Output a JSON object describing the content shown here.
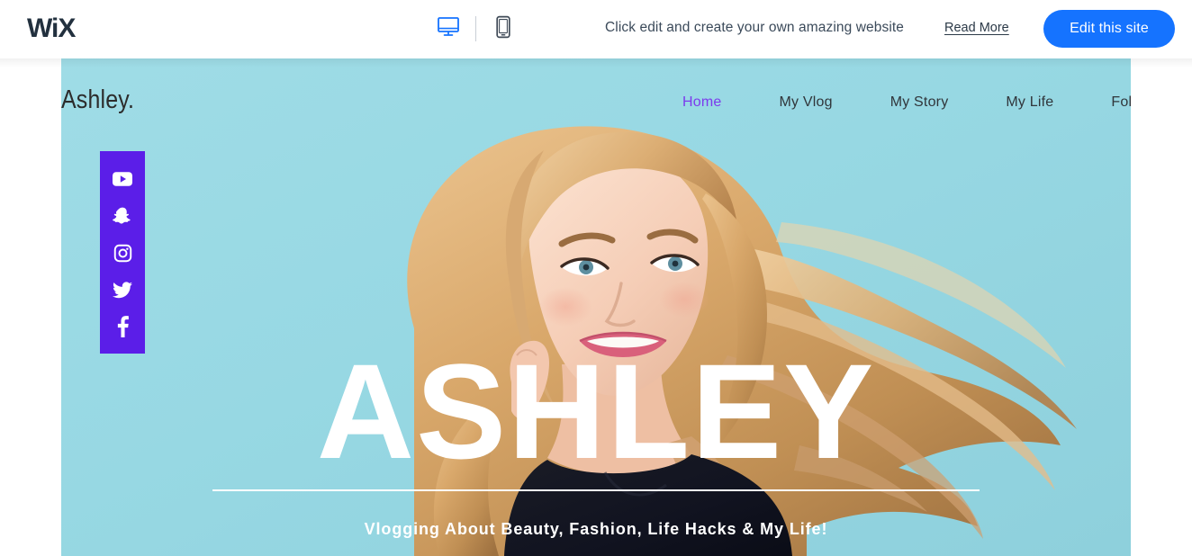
{
  "editor_bar": {
    "logo_text": "WiX",
    "views": [
      {
        "name": "desktop-view",
        "icon": "desktop-icon",
        "active": true
      },
      {
        "name": "mobile-view",
        "icon": "mobile-icon",
        "active": false
      }
    ],
    "promo_text": "Click edit and create your own amazing website",
    "read_more_label": "Read More",
    "edit_button_label": "Edit this site",
    "accent_color": "#1573FF",
    "logo_color": "#22303E"
  },
  "site": {
    "logo": "Ashley.",
    "background_color": "#9BD9E4",
    "nav": [
      {
        "label": "Home",
        "active": true
      },
      {
        "label": "My Vlog",
        "active": false
      },
      {
        "label": "My Story",
        "active": false
      },
      {
        "label": "My Life",
        "active": false
      },
      {
        "label": "Follow Me",
        "active": false
      }
    ],
    "nav_active_color": "#7C3AED",
    "social_bar": {
      "background_color": "#5B1EE8",
      "items": [
        {
          "icon": "youtube-icon",
          "label": "YouTube"
        },
        {
          "icon": "snapchat-icon",
          "label": "Snapchat"
        },
        {
          "icon": "instagram-icon",
          "label": "Instagram"
        },
        {
          "icon": "twitter-icon",
          "label": "Twitter"
        },
        {
          "icon": "facebook-icon",
          "label": "Facebook"
        }
      ]
    },
    "hero": {
      "title": "ASHLEY",
      "tagline": "Vlogging About Beauty, Fashion, Life Hacks & My Life!",
      "image_alt": "Portrait of a smiling blonde woman with flowing hair on a teal background"
    }
  }
}
